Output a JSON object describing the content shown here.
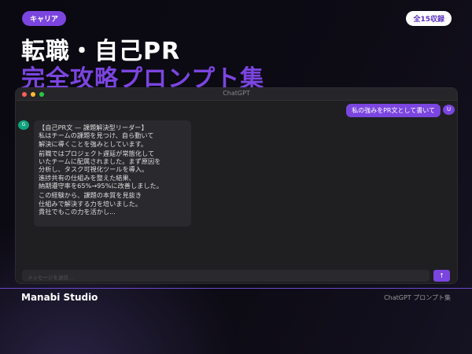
{
  "header": {
    "category_tag": "キャリア",
    "count_badge": "全15収録",
    "title_line1": "転職・自己PR",
    "title_line2": "完全攻略プロンプト集"
  },
  "window": {
    "title": "ChatGPT",
    "user_message": "私の強みをPR文として書いて",
    "user_avatar": "U",
    "assistant_avatar": "G",
    "assistant_paragraphs": [
      [
        "【自己PR文 — 課題解決型リーダー】",
        "私はチームの課題を見つけ、自ら動いて",
        "解決に導くことを強みとしています。"
      ],
      [
        "前職ではプロジェクト遅延が常態化して",
        "いたチームに配属されました。まず原因を",
        "分析し、タスク可視化ツールを導入。",
        "進捗共有の仕組みを整えた結果、",
        "納期遵守率を65%→95%に改善しました。"
      ],
      [
        "この経験から、課題の本質を見抜き",
        "仕組みで解決する力を培いました。",
        "貴社でもこの力を活かし..."
      ]
    ],
    "input_placeholder": "メッセージを送信...",
    "send_icon": "↑"
  },
  "footer": {
    "brand": "Manabi Studio",
    "subtitle": "ChatGPT プロンプト集"
  },
  "colors": {
    "accent": "#7b45e0",
    "assistant_avatar": "#10a37f"
  }
}
